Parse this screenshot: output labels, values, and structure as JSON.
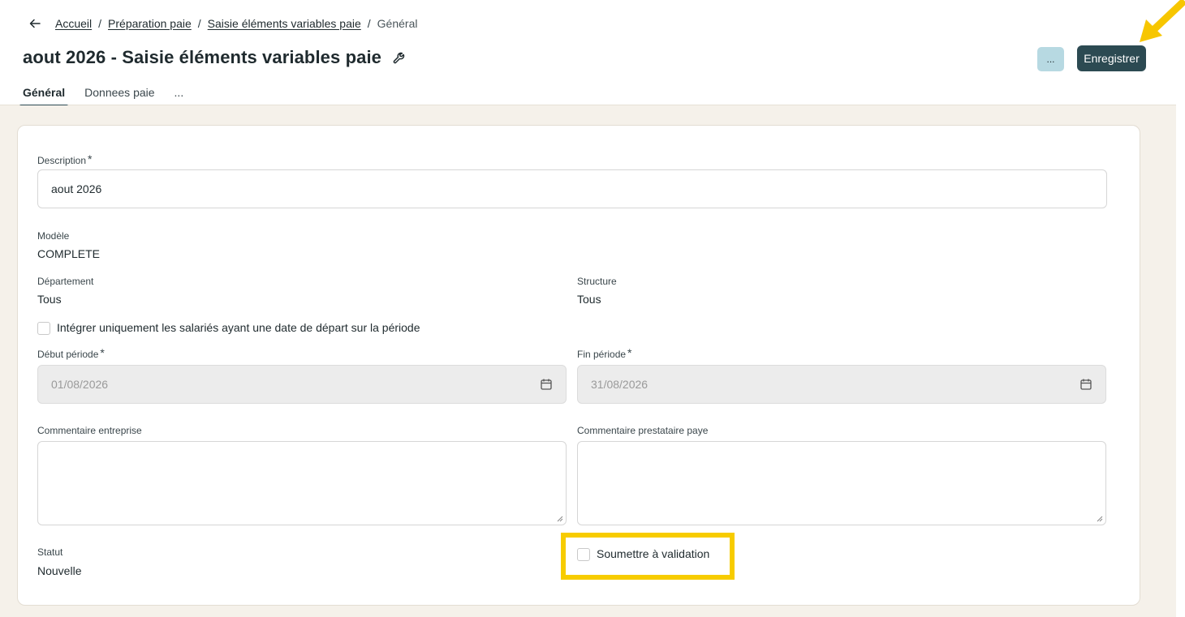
{
  "breadcrumb": {
    "items": [
      "Accueil",
      "Préparation paie",
      "Saisie éléments variables paie"
    ],
    "separator": "/",
    "current": "Général"
  },
  "page": {
    "title": "aout 2026 - Saisie éléments variables paie"
  },
  "actions": {
    "more_label": "...",
    "save_label": "Enregistrer"
  },
  "tabs": [
    {
      "label": "Général",
      "active": true
    },
    {
      "label": "Donnees paie",
      "active": false
    },
    {
      "label": "...",
      "active": false
    }
  ],
  "form": {
    "description": {
      "label": "Description",
      "required": "*",
      "value": "aout 2026"
    },
    "modele": {
      "label": "Modèle",
      "value": "COMPLETE"
    },
    "departement": {
      "label": "Département",
      "value": "Tous"
    },
    "structure": {
      "label": "Structure",
      "value": "Tous"
    },
    "integrer": {
      "label": "Intégrer uniquement les salariés ayant une date de départ sur la période",
      "checked": false
    },
    "debut": {
      "label": "Début période",
      "required": "*",
      "value": "01/08/2026"
    },
    "fin": {
      "label": "Fin période",
      "required": "*",
      "value": "31/08/2026"
    },
    "commentaire_entreprise": {
      "label": "Commentaire entreprise",
      "value": ""
    },
    "commentaire_prestataire": {
      "label": "Commentaire prestataire paye",
      "value": ""
    },
    "statut": {
      "label": "Statut",
      "value": "Nouvelle"
    },
    "soumettre": {
      "label": "Soumettre à validation",
      "checked": false
    }
  },
  "colors": {
    "primary": "#2c4a52",
    "secondary_button": "#b7d9e2",
    "page_background": "#f5f1ea",
    "highlight": "#f7cc00"
  },
  "icons": [
    "back-arrow-icon",
    "wrench-icon",
    "calendar-icon",
    "arrow-annotation-icon"
  ]
}
